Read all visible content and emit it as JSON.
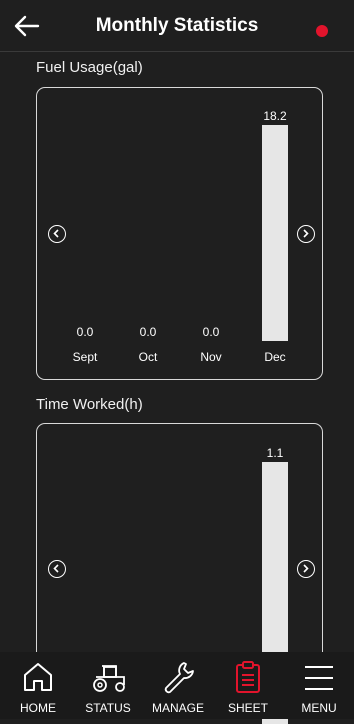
{
  "header": {
    "title": "Monthly Statistics",
    "status_color": "#e2142c"
  },
  "sections": {
    "fuel": {
      "label": "Fuel Usage(gal)"
    },
    "time": {
      "label": "Time Worked(h)"
    }
  },
  "chart_data": [
    {
      "type": "bar",
      "title": "Fuel Usage(gal)",
      "categories": [
        "Sept",
        "Oct",
        "Nov",
        "Dec"
      ],
      "values": [
        0.0,
        0.0,
        0.0,
        18.2
      ],
      "value_labels": [
        "0.0",
        "0.0",
        "0.0",
        "18.2"
      ],
      "ylim": [
        0,
        18.2
      ]
    },
    {
      "type": "bar",
      "title": "Time Worked(h)",
      "categories": [],
      "values": [
        1.1
      ],
      "value_labels": [
        "1.1"
      ],
      "ylim": [
        0,
        1.1
      ]
    }
  ],
  "nav": {
    "items": [
      {
        "label": "HOME",
        "icon": "home-icon"
      },
      {
        "label": "STATUS",
        "icon": "tractor-icon"
      },
      {
        "label": "MANAGE",
        "icon": "wrench-icon"
      },
      {
        "label": "SHEET",
        "icon": "clipboard-icon"
      },
      {
        "label": "MENU",
        "icon": "hamburger-icon"
      }
    ],
    "active_index": 3,
    "active_color": "#e2142c"
  }
}
